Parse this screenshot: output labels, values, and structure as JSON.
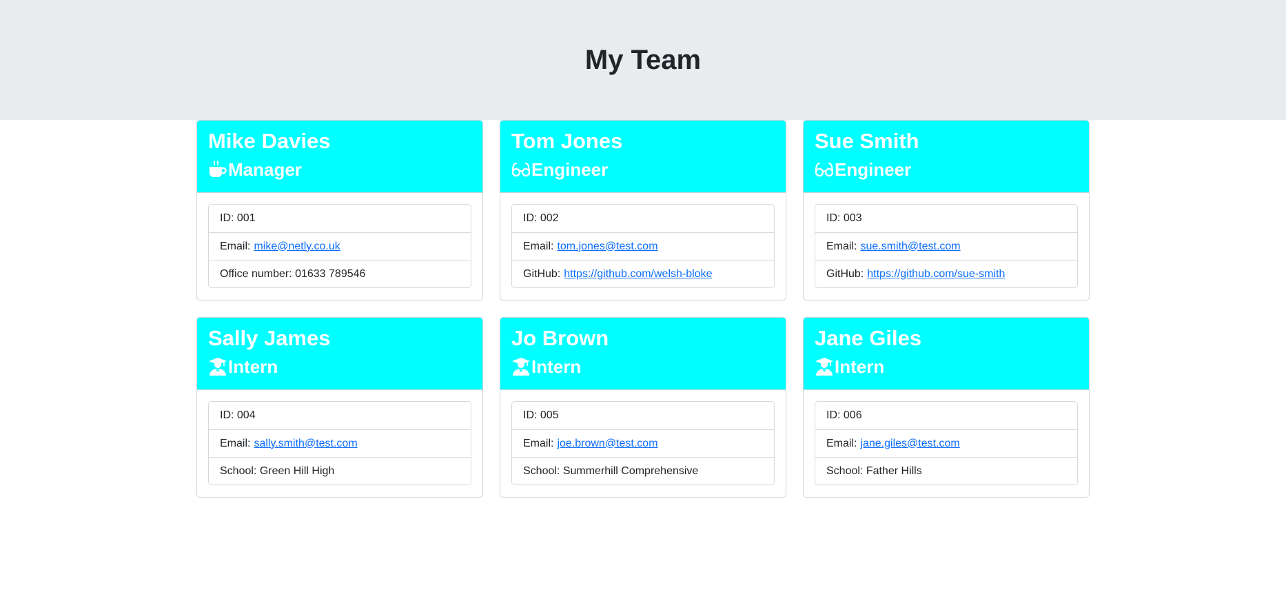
{
  "header": {
    "title": "My Team"
  },
  "theme": {
    "card_header_color": "#00ffff",
    "jumbotron_color": "#e9ecef",
    "link_color": "#0d6efd"
  },
  "employees": [
    {
      "name": "Mike Davies",
      "role": "Manager",
      "icon": "mug-hot-icon",
      "id_label": "ID: 001",
      "email_label": "Email:",
      "email": "mike@netly.co.uk",
      "extra_label": "Office number: 01633 789546",
      "extra_link": ""
    },
    {
      "name": "Tom Jones",
      "role": "Engineer",
      "icon": "glasses-icon",
      "id_label": "ID: 002",
      "email_label": "Email:",
      "email": "tom.jones@test.com",
      "extra_label": "GitHub:",
      "extra_link": "https://github.com/welsh-bloke"
    },
    {
      "name": "Sue Smith",
      "role": "Engineer",
      "icon": "glasses-icon",
      "id_label": "ID: 003",
      "email_label": "Email:",
      "email": "sue.smith@test.com",
      "extra_label": "GitHub:",
      "extra_link": "https://github.com/sue-smith"
    },
    {
      "name": "Sally James",
      "role": "Intern",
      "icon": "graduate-icon",
      "id_label": "ID: 004",
      "email_label": "Email:",
      "email": "sally.smith@test.com",
      "extra_label": "School: Green Hill High",
      "extra_link": ""
    },
    {
      "name": "Jo Brown",
      "role": "Intern",
      "icon": "graduate-icon",
      "id_label": "ID: 005",
      "email_label": "Email:",
      "email": "joe.brown@test.com",
      "extra_label": "School: Summerhill Comprehensive",
      "extra_link": ""
    },
    {
      "name": "Jane Giles",
      "role": "Intern",
      "icon": "graduate-icon",
      "id_label": "ID: 006",
      "email_label": "Email:",
      "email": "jane.giles@test.com",
      "extra_label": "School: Father Hills",
      "extra_link": ""
    }
  ]
}
